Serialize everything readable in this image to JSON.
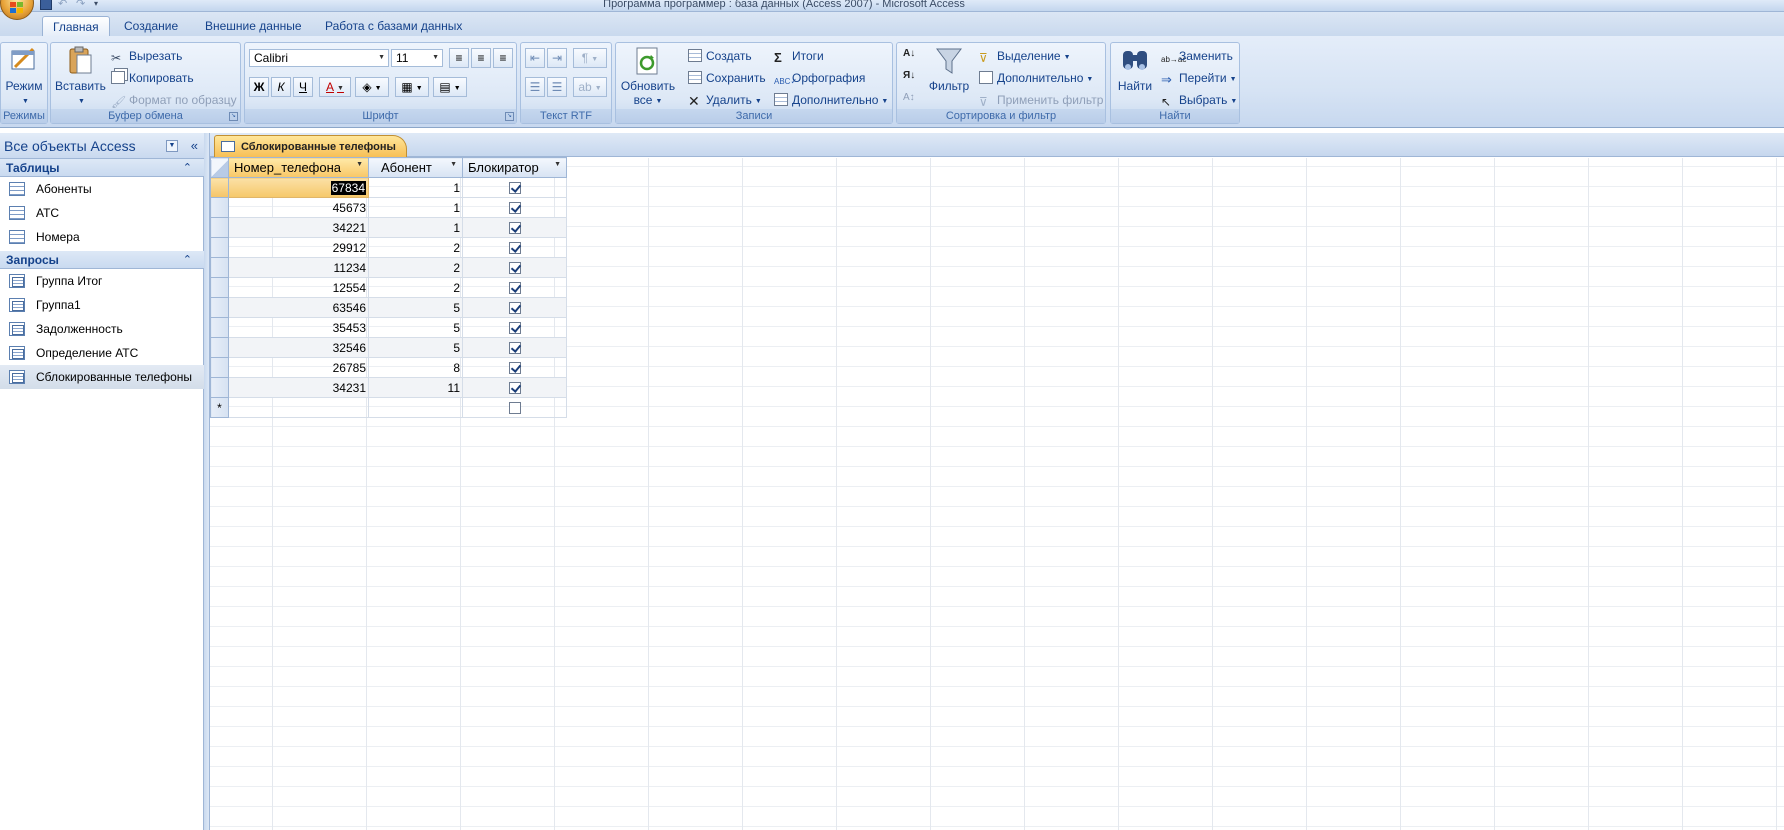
{
  "window": {
    "title": "Программа программер : база данных (Access 2007) - Microsoft Access"
  },
  "tabs": [
    "Главная",
    "Создание",
    "Внешние данные",
    "Работа с базами данных"
  ],
  "ribbon": {
    "views": {
      "mode_label": "Режим",
      "group_label": "Режимы"
    },
    "clipboard": {
      "paste_label": "Вставить",
      "cut_label": "Вырезать",
      "copy_label": "Копировать",
      "format_painter_label": "Формат по образцу",
      "group_label": "Буфер обмена"
    },
    "font": {
      "font_name": "Calibri",
      "font_size": "11",
      "bold": "Ж",
      "italic": "К",
      "underline": "Ч",
      "font_color": "A",
      "group_label": "Шрифт"
    },
    "rtf": {
      "group_label": "Текст RTF"
    },
    "records": {
      "refresh_label_1": "Обновить",
      "refresh_label_2": "все",
      "new_label": "Создать",
      "save_label": "Сохранить",
      "delete_label": "Удалить",
      "totals_label": "Итоги",
      "spelling_label": "Орфография",
      "more_label": "Дополнительно",
      "group_label": "Записи"
    },
    "sort": {
      "filter_label": "Фильтр",
      "selection_label": "Выделение",
      "advanced_label": "Дополнительно",
      "apply_filter_label": "Применить фильтр",
      "group_label": "Сортировка и фильтр"
    },
    "find": {
      "find_label": "Найти",
      "replace_label": "Заменить",
      "goto_label": "Перейти",
      "select_label": "Выбрать",
      "group_label": "Найти"
    }
  },
  "nav": {
    "header": "Все объекты Access",
    "tables_section": "Таблицы",
    "tables": [
      "Абоненты",
      "АТС",
      "Номера"
    ],
    "queries_section": "Запросы",
    "queries": [
      "Группа Итог",
      "Группа1",
      "Задолженность",
      "Определение АТС",
      "Сблокированные телефоны"
    ],
    "selected_query": "Сблокированные телефоны"
  },
  "document": {
    "tab_label": "Сблокированные телефоны",
    "columns": [
      "Номер_телефона",
      "Абонент",
      "Блокиратор"
    ],
    "rows": [
      {
        "phone": "67834",
        "subscriber": "1",
        "blocked": true
      },
      {
        "phone": "45673",
        "subscriber": "1",
        "blocked": true
      },
      {
        "phone": "34221",
        "subscriber": "1",
        "blocked": true
      },
      {
        "phone": "29912",
        "subscriber": "2",
        "blocked": true
      },
      {
        "phone": "11234",
        "subscriber": "2",
        "blocked": true
      },
      {
        "phone": "12554",
        "subscriber": "2",
        "blocked": true
      },
      {
        "phone": "63546",
        "subscriber": "5",
        "blocked": true
      },
      {
        "phone": "35453",
        "subscriber": "5",
        "blocked": true
      },
      {
        "phone": "32546",
        "subscriber": "5",
        "blocked": true
      },
      {
        "phone": "26785",
        "subscriber": "8",
        "blocked": true
      },
      {
        "phone": "34231",
        "subscriber": "11",
        "blocked": true
      }
    ],
    "new_row_marker": "*"
  }
}
